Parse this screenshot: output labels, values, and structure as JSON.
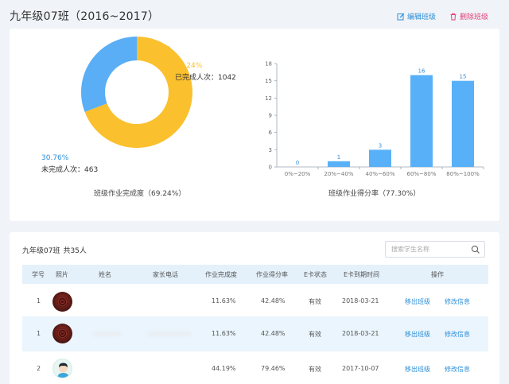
{
  "header": {
    "title": "九年级07班（2016~2017）",
    "edit_label": "编辑班级",
    "delete_label": "删除班级"
  },
  "colors": {
    "accent_blue": "#2e8fd8",
    "delete_pink": "#e0457b",
    "donut_yellow": "#fbc02d",
    "donut_blue": "#5aaef5",
    "bar_blue": "#58b1f8"
  },
  "donut": {
    "completed_pct": "69.24%",
    "completed_label": "已完成人次：1042",
    "uncompleted_pct": "30.76%",
    "uncompleted_label": "未完成人次：463",
    "caption": "班级作业完成度（69.24%）"
  },
  "chart_data": [
    {
      "type": "pie",
      "categories": [
        "已完成人次",
        "未完成人次"
      ],
      "values": [
        1042,
        463
      ],
      "percent": [
        69.24,
        30.76
      ],
      "colors": [
        "#fbc02d",
        "#5aaef5"
      ],
      "title": "班级作业完成度（69.24%）"
    },
    {
      "type": "bar",
      "categories": [
        "0%~20%",
        "20%~40%",
        "40%~60%",
        "60%~80%",
        "80%~100%"
      ],
      "values": [
        0,
        1,
        3,
        16,
        15
      ],
      "yticks": [
        "0",
        "3",
        "6",
        "9",
        "12",
        "15",
        "18"
      ],
      "ylim": [
        0,
        18
      ],
      "grid": false,
      "title": "班级作业得分率（77.30%）"
    }
  ],
  "summary": {
    "class_name": "九年级07班",
    "count": "共35人"
  },
  "search": {
    "placeholder": "搜索学生名称"
  },
  "table": {
    "headers": [
      "学号",
      "照片",
      "姓名",
      "家长电话",
      "作业完成度",
      "作业得分率",
      "E卡状态",
      "E卡到期时间",
      "操作"
    ],
    "rows": [
      {
        "id": "1",
        "completion": "11.63%",
        "score": "42.48%",
        "card_status": "有效",
        "expiry": "2018-03-21",
        "op_move": "移出班级",
        "op_edit": "修改信息"
      },
      {
        "id": "1",
        "completion": "11.63%",
        "score": "42.48%",
        "card_status": "有效",
        "expiry": "2018-03-21",
        "op_move": "移出班级",
        "op_edit": "修改信息"
      },
      {
        "id": "2",
        "completion": "44.19%",
        "score": "79.46%",
        "card_status": "有效",
        "expiry": "2017-10-07",
        "op_move": "移出班级",
        "op_edit": "修改信息"
      }
    ]
  }
}
